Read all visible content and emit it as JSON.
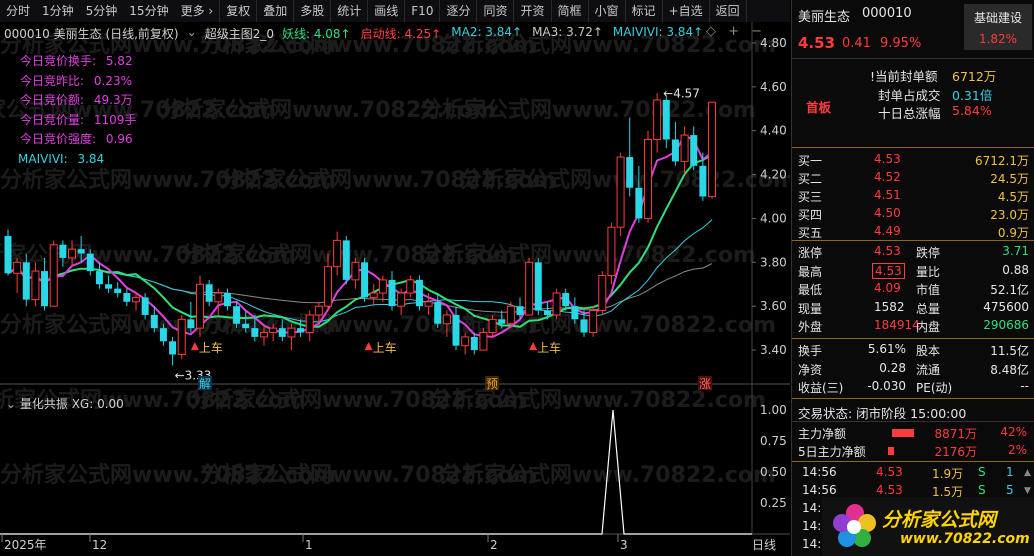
{
  "toolbar": {
    "items": [
      "分时",
      "1分钟",
      "5分钟",
      "15分钟",
      "更多 ›",
      "复权",
      "叠加",
      "多股",
      "统计",
      "画线",
      "F10",
      "逐分",
      "同资",
      "开资",
      "简框",
      "小窗",
      "标记",
      "+自选",
      "返回"
    ]
  },
  "header": {
    "code_name": "000010 美丽生态 (日线,前复权)",
    "indicator": "超级主图2_0",
    "ma_items": [
      {
        "label": "妖线: 4.08↑",
        "color": "#2ee07a"
      },
      {
        "label": "启动线: 4.25↑",
        "color": "#ff4040"
      },
      {
        "label": "MA2: 3.84↑",
        "color": "#38d0e0"
      },
      {
        "label": "MA3: 3.72↑",
        "color": "#c8c8c8"
      },
      {
        "label": "MAIVIVI: 3.84↑",
        "color": "#38d0e0"
      }
    ]
  },
  "stats": [
    {
      "label": "今日竞价换手:",
      "value": "5.82",
      "color": "#e040e0"
    },
    {
      "label": "今日竞昨比:",
      "value": "0.23%",
      "color": "#e040e0"
    },
    {
      "label": "今日竞价额:",
      "value": "49.3万",
      "color": "#e040e0"
    },
    {
      "label": "今日竞价量:",
      "value": "1109手",
      "color": "#e040e0"
    },
    {
      "label": "今日竞价强度:",
      "value": "0.96",
      "color": "#e040e0"
    },
    {
      "label": "MAIVIVI:",
      "value": "3.84",
      "color": "#38d0e0"
    }
  ],
  "price_axis": [
    "4.80",
    "4.60",
    "4.40",
    "4.20",
    "4.00",
    "3.80",
    "3.60",
    "3.40"
  ],
  "price_annotations": {
    "high": "4.57",
    "low": "3.33"
  },
  "signals": [
    "上车",
    "上车",
    "上车"
  ],
  "markers": [
    "解",
    "预",
    "涨"
  ],
  "sub_chart": {
    "title": "量化共振 XG: 0.00",
    "axis": [
      "1.00",
      "0.75",
      "0.50",
      "0.25"
    ]
  },
  "date_axis": {
    "labels": [
      "2025年",
      "12",
      "1",
      "2",
      "3"
    ],
    "period": "日线"
  },
  "watermark": "分析家公式网www.70822.com",
  "quote": {
    "name": "美丽生态",
    "code": "000010",
    "price": "4.53",
    "change": "0.41",
    "pct": "9.95%",
    "tag": "基础建设",
    "tag_pct": "1.82%",
    "board": "首板",
    "seal_amount_label": "!当前封单额",
    "seal_amount": "6712万",
    "seal_ratio_label": "封单占成交",
    "seal_ratio": "0.31倍",
    "ten_day_label": "十日总涨幅",
    "ten_day": "5.84%"
  },
  "order_book": [
    {
      "label": "买一",
      "price": "4.53",
      "vol": "6712.1万"
    },
    {
      "label": "买二",
      "price": "4.52",
      "vol": "24.5万"
    },
    {
      "label": "买三",
      "price": "4.51",
      "vol": "4.5万"
    },
    {
      "label": "买四",
      "price": "4.50",
      "vol": "23.0万"
    },
    {
      "label": "买五",
      "price": "4.49",
      "vol": "0.9万"
    }
  ],
  "details": [
    {
      "l1": "涨停",
      "v1": "4.53",
      "c1": "#ff3b3b",
      "l2": "跌停",
      "v2": "3.71",
      "c2": "#2ee07a"
    },
    {
      "l1": "最高",
      "v1": "4.53",
      "c1": "#ff3b3b",
      "l2": "量比",
      "v2": "0.88",
      "c2": "#e6e6e6"
    },
    {
      "l1": "最低",
      "v1": "4.09",
      "c1": "#ff3b3b",
      "l2": "市值",
      "v2": "52.1亿",
      "c2": "#e6e6e6"
    },
    {
      "l1": "现量",
      "v1": "1582",
      "c1": "#e6e6e6",
      "l2": "总量",
      "v2": "475600",
      "c2": "#e6e6e6"
    },
    {
      "l1": "外盘",
      "v1": "184914",
      "c1": "#ff3b3b",
      "l2": "内盘",
      "v2": "290686",
      "c2": "#2ee07a"
    }
  ],
  "details2": [
    {
      "l1": "换手",
      "v1": "5.61%",
      "l2": "股本",
      "v2": "11.5亿"
    },
    {
      "l1": "净资",
      "v1": "0.28",
      "l2": "流通",
      "v2": "8.48亿"
    },
    {
      "l1": "收益(三)",
      "v1": "-0.030",
      "l2": "PE(动)",
      "v2": "--"
    }
  ],
  "trade_status": "交易状态: 闭市阶段 15:00:00",
  "fund_flow": [
    {
      "label": "主力净额",
      "value": "8871万",
      "pct": "42%"
    },
    {
      "label": "5日主力净额",
      "value": "2176万",
      "pct": "2%"
    }
  ],
  "ticks": [
    {
      "time": "14:56",
      "price": "4.53",
      "vol": "1.9万",
      "side": "S",
      "n": "1"
    },
    {
      "time": "14:56",
      "price": "4.53",
      "vol": "1.5万",
      "side": "S",
      "n": "5"
    },
    {
      "time": "14:5",
      "price": "",
      "vol": "",
      "side": "",
      "n": ""
    },
    {
      "time": "14:5",
      "price": "",
      "vol": "",
      "side": "",
      "n": ""
    },
    {
      "time": "14:5",
      "price": "",
      "vol": "",
      "side": "",
      "n": ""
    }
  ],
  "logo": {
    "text": "分析家公式网",
    "url": "www.70822.com"
  },
  "chart_data": {
    "type": "candlestick",
    "y_range": [
      3.3,
      4.85
    ],
    "candles": [
      [
        3.92,
        3.95,
        3.74,
        3.75
      ],
      [
        3.75,
        3.82,
        3.66,
        3.8
      ],
      [
        3.8,
        3.84,
        3.6,
        3.63
      ],
      [
        3.63,
        3.8,
        3.6,
        3.76
      ],
      [
        3.76,
        3.82,
        3.58,
        3.6
      ],
      [
        3.6,
        3.9,
        3.6,
        3.88
      ],
      [
        3.88,
        3.9,
        3.78,
        3.82
      ],
      [
        3.82,
        3.9,
        3.78,
        3.86
      ],
      [
        3.86,
        3.92,
        3.8,
        3.84
      ],
      [
        3.84,
        3.86,
        3.74,
        3.76
      ],
      [
        3.76,
        3.8,
        3.68,
        3.7
      ],
      [
        3.7,
        3.74,
        3.66,
        3.68
      ],
      [
        3.68,
        3.71,
        3.64,
        3.66
      ],
      [
        3.66,
        3.68,
        3.6,
        3.62
      ],
      [
        3.62,
        3.66,
        3.58,
        3.64
      ],
      [
        3.64,
        3.66,
        3.54,
        3.56
      ],
      [
        3.56,
        3.6,
        3.48,
        3.5
      ],
      [
        3.5,
        3.52,
        3.42,
        3.44
      ],
      [
        3.44,
        3.46,
        3.33,
        3.38
      ],
      [
        3.38,
        3.56,
        3.36,
        3.54
      ],
      [
        3.54,
        3.62,
        3.48,
        3.5
      ],
      [
        3.5,
        3.74,
        3.46,
        3.7
      ],
      [
        3.7,
        3.72,
        3.6,
        3.62
      ],
      [
        3.62,
        3.68,
        3.56,
        3.66
      ],
      [
        3.66,
        3.68,
        3.58,
        3.6
      ],
      [
        3.6,
        3.62,
        3.5,
        3.52
      ],
      [
        3.52,
        3.58,
        3.48,
        3.5
      ],
      [
        3.5,
        3.56,
        3.44,
        3.46
      ],
      [
        3.46,
        3.52,
        3.42,
        3.48
      ],
      [
        3.48,
        3.52,
        3.44,
        3.5
      ],
      [
        3.5,
        3.54,
        3.44,
        3.46
      ],
      [
        3.46,
        3.52,
        3.4,
        3.5
      ],
      [
        3.5,
        3.54,
        3.46,
        3.48
      ],
      [
        3.48,
        3.58,
        3.44,
        3.56
      ],
      [
        3.56,
        3.62,
        3.52,
        3.6
      ],
      [
        3.6,
        3.84,
        3.58,
        3.78
      ],
      [
        3.78,
        3.94,
        3.74,
        3.9
      ],
      [
        3.9,
        3.92,
        3.7,
        3.72
      ],
      [
        3.72,
        3.82,
        3.68,
        3.8
      ],
      [
        3.8,
        3.82,
        3.62,
        3.64
      ],
      [
        3.64,
        3.7,
        3.6,
        3.66
      ],
      [
        3.66,
        3.74,
        3.62,
        3.72
      ],
      [
        3.72,
        3.76,
        3.58,
        3.6
      ],
      [
        3.6,
        3.68,
        3.56,
        3.66
      ],
      [
        3.66,
        3.74,
        3.64,
        3.72
      ],
      [
        3.72,
        3.74,
        3.58,
        3.6
      ],
      [
        3.6,
        3.66,
        3.56,
        3.62
      ],
      [
        3.62,
        3.66,
        3.5,
        3.52
      ],
      [
        3.52,
        3.58,
        3.46,
        3.56
      ],
      [
        3.56,
        3.6,
        3.4,
        3.42
      ],
      [
        3.42,
        3.48,
        3.38,
        3.46
      ],
      [
        3.46,
        3.48,
        3.38,
        3.4
      ],
      [
        3.4,
        3.5,
        3.4,
        3.48
      ],
      [
        3.48,
        3.56,
        3.46,
        3.54
      ],
      [
        3.54,
        3.58,
        3.5,
        3.52
      ],
      [
        3.52,
        3.62,
        3.5,
        3.6
      ],
      [
        3.6,
        3.64,
        3.54,
        3.56
      ],
      [
        3.56,
        3.82,
        3.56,
        3.8
      ],
      [
        3.8,
        3.82,
        3.56,
        3.58
      ],
      [
        3.58,
        3.62,
        3.54,
        3.56
      ],
      [
        3.56,
        3.68,
        3.54,
        3.66
      ],
      [
        3.66,
        3.68,
        3.58,
        3.6
      ],
      [
        3.6,
        3.64,
        3.52,
        3.54
      ],
      [
        3.54,
        3.58,
        3.46,
        3.48
      ],
      [
        3.48,
        3.6,
        3.46,
        3.58
      ],
      [
        3.58,
        3.76,
        3.56,
        3.74
      ],
      [
        3.74,
        3.98,
        3.7,
        3.96
      ],
      [
        3.96,
        4.3,
        3.92,
        4.28
      ],
      [
        4.28,
        4.46,
        4.1,
        4.14
      ],
      [
        4.14,
        4.24,
        3.98,
        4.0
      ],
      [
        4.0,
        4.4,
        3.98,
        4.36
      ],
      [
        4.36,
        4.57,
        4.3,
        4.54
      ],
      [
        4.54,
        4.56,
        4.32,
        4.36
      ],
      [
        4.36,
        4.44,
        4.24,
        4.26
      ],
      [
        4.26,
        4.42,
        4.2,
        4.38
      ],
      [
        4.38,
        4.42,
        4.22,
        4.24
      ],
      [
        4.24,
        4.3,
        4.08,
        4.1
      ],
      [
        4.1,
        4.53,
        4.09,
        4.53
      ]
    ]
  }
}
